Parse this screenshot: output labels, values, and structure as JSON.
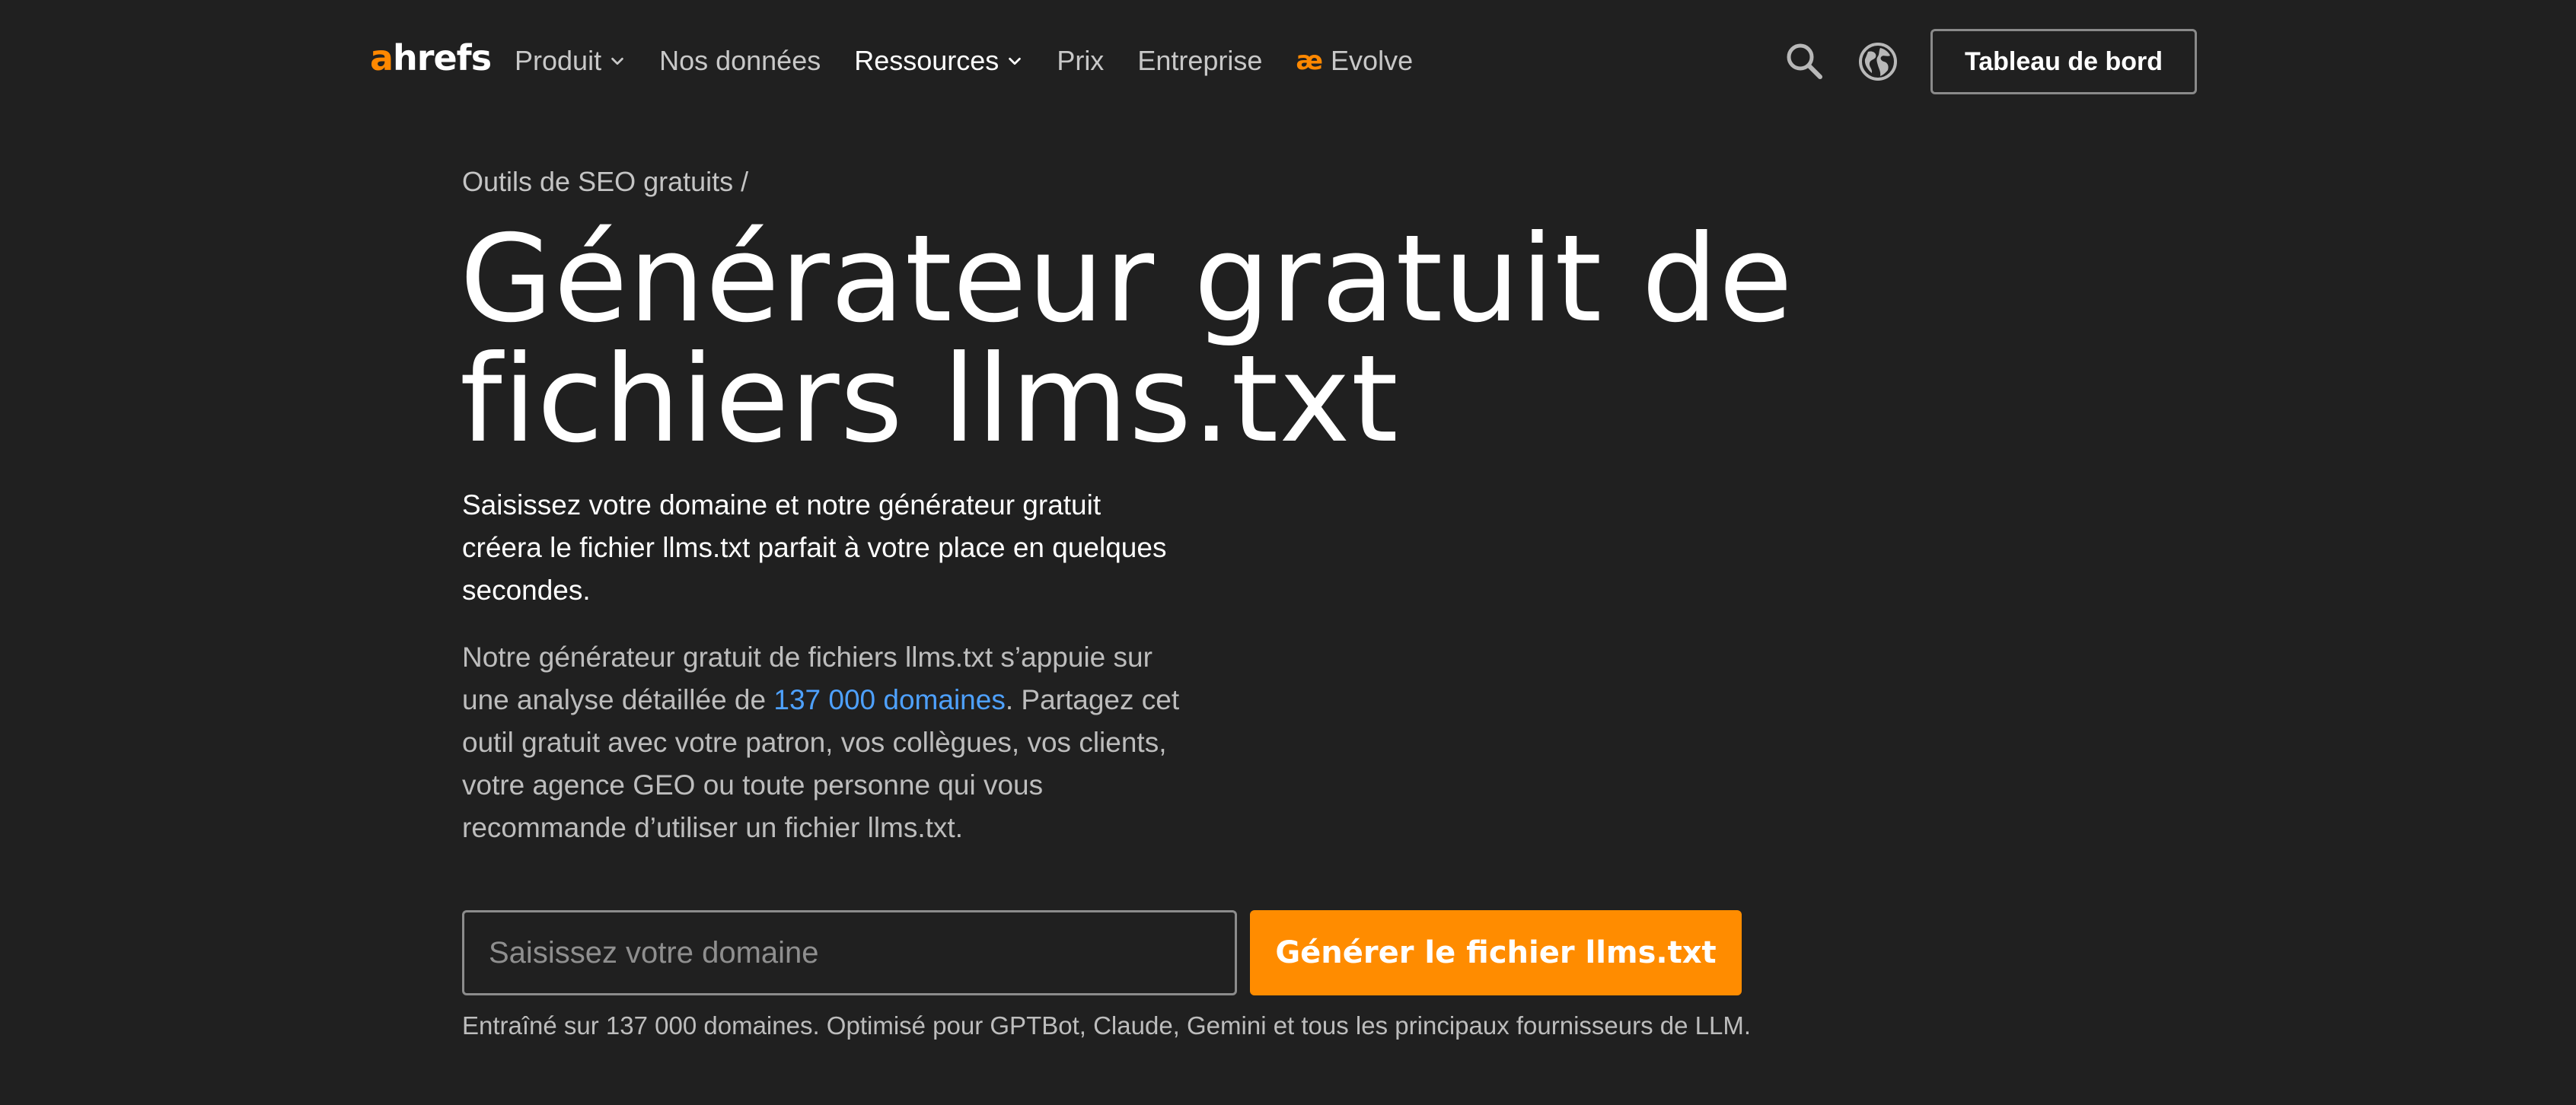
{
  "header": {
    "logo": {
      "first": "a",
      "rest": "hrefs"
    },
    "nav": [
      {
        "label": "Produit",
        "dropdown": true,
        "active": false
      },
      {
        "label": "Nos données",
        "dropdown": false,
        "active": false
      },
      {
        "label": "Ressources",
        "dropdown": true,
        "active": true
      },
      {
        "label": "Prix",
        "dropdown": false,
        "active": false
      },
      {
        "label": "Entreprise",
        "dropdown": false,
        "active": false
      },
      {
        "label": "Evolve",
        "dropdown": false,
        "active": false,
        "icon": "æ"
      }
    ],
    "icons": {
      "search": "search-icon",
      "language": "globe-icon"
    },
    "dashboard_label": "Tableau de bord"
  },
  "main": {
    "breadcrumb": "Outils de SEO gratuits /",
    "title_line1": "Générateur gratuit de",
    "title_line2": "fichiers llms.txt",
    "lede": "Saisissez votre domaine et notre générateur gratuit créera le fichier llms.txt parfait à votre place en quelques secondes.",
    "desc_before": "Notre générateur gratuit de fichiers llms.txt s’appuie sur une analyse détaillée de ",
    "desc_link": "137 000 domaines",
    "desc_after": ". Partagez cet outil gratuit avec votre patron, vos collègues, vos clients, votre agence GEO ou toute personne qui vous recommande d’utiliser un fichier llms.txt.",
    "input_placeholder": "Saisissez votre domaine",
    "input_value": "",
    "submit_label": "Générer le fichier llms.txt",
    "footnote": "Entraîné sur 137 000 domaines. Optimisé pour GPTBot, Claude, Gemini et tous les principaux fournisseurs de LLM."
  },
  "colors": {
    "background": "#202020",
    "accent": "#ff8c00",
    "link": "#4ea1ff",
    "text_primary": "#ffffff",
    "text_secondary": "#bdbdbd"
  }
}
